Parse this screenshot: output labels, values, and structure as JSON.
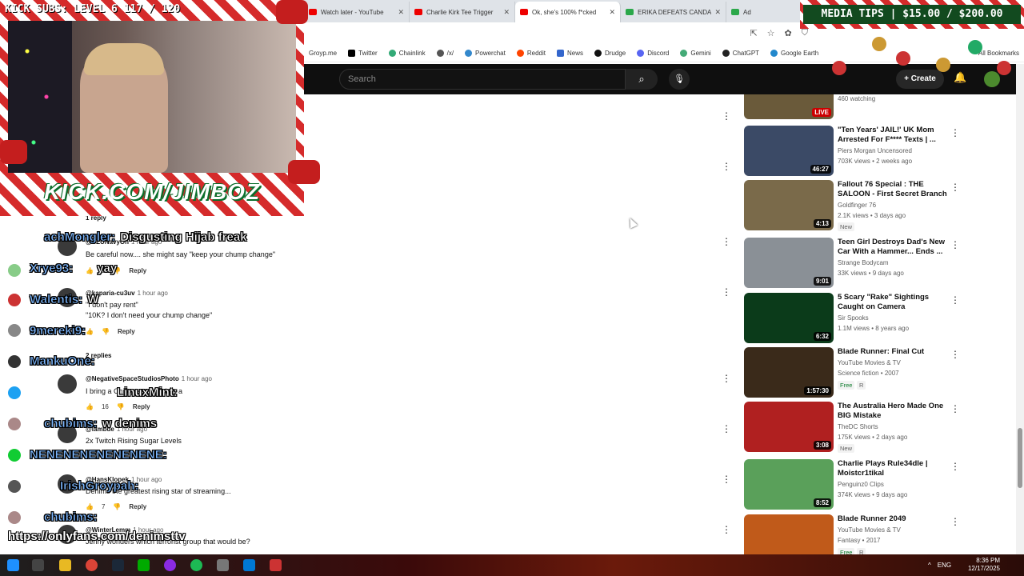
{
  "browser": {
    "tabs": [
      {
        "title": "Watch later - YouTube",
        "active": false,
        "favicon": "youtube"
      },
      {
        "title": "Charlie Kirk Tee Trigger",
        "active": false,
        "favicon": "youtube"
      },
      {
        "title": "Ok, she's 100% f*cked",
        "active": true,
        "favicon": "youtube"
      },
      {
        "title": "ERIKA DEFEATS CANDA",
        "active": false,
        "favicon": "rumble"
      },
      {
        "title": "Ad",
        "active": false,
        "favicon": "kick"
      }
    ],
    "bookmarks": [
      "Groyp.me",
      "Twitter",
      "Chainlink",
      "/x/",
      "Powerchat",
      "Reddit",
      "News",
      "Drudge",
      "Discord",
      "Gemini",
      "ChatGPT",
      "Google Earth"
    ],
    "all_bookmarks_label": "All Bookmarks"
  },
  "youtube": {
    "search_placeholder": "Search",
    "create_label": "Create"
  },
  "overlay": {
    "kick_subs": "KICK SUBS: LEVEL 6 117 / 120",
    "media_tips": "MEDIA TIPS | $15.00 / $200.00",
    "channel_url": "KICK.COM/JIMBOZ",
    "bottom_url": "https://onlyfans.com/denimsttv"
  },
  "chat": [
    {
      "name": "achMongler:",
      "message": "Disgusting Hijab freak"
    },
    {
      "name": "Xrye93:",
      "message": "yay"
    },
    {
      "name": "Walentis:",
      "message": "W"
    },
    {
      "name": "9mereki9:",
      "message": ""
    },
    {
      "name": "MankuOne:",
      "message": ""
    },
    {
      "name": "",
      "message": "LinuxMint:"
    },
    {
      "name": "chubims:",
      "message": "w denims"
    },
    {
      "name": "NENENENENENENENE:",
      "message": ""
    },
    {
      "name": "IrishGroypah:",
      "message": ""
    },
    {
      "name": "chubims:",
      "message": ""
    }
  ],
  "comments": [
    {
      "author": "@SZUNavyOn",
      "ago": "1 hour ago",
      "text": "Be careful now.... she might say \"keep your chump change\"",
      "likes": "3",
      "reply": "Reply"
    },
    {
      "author": "@kaparia-cu3uv",
      "ago": "1 hour ago",
      "text": "\"I don't pay rent\"",
      "text2": "\"10K? I don't need your chump change\"",
      "likes": "",
      "reply": "Reply",
      "replies_label": "2 replies"
    },
    {
      "author": "@NegativeSpaceStudiosPhoto",
      "ago": "1 hour ago",
      "text": "I bring a Chiropractor makes a",
      "likes": "16",
      "reply": "Reply"
    },
    {
      "author": "@iambde",
      "ago": "1 hour ago",
      "text": "2x Twitch Rising Sugar Levels",
      "likes": "",
      "reply": ""
    },
    {
      "author": "@HansKlopek",
      "ago": "1 hour ago",
      "text": "Denims the greatest rising star of streaming...",
      "likes": "7",
      "reply": "Reply"
    },
    {
      "author": "@WinterLemm",
      "ago": "1 hour ago",
      "text": "Jenny wonders which terrorist group that would be?",
      "likes": "",
      "reply": ""
    }
  ],
  "first_replies_label": "1 reply",
  "sidebar": [
    {
      "title": "",
      "channel": "460 watching",
      "meta": "",
      "duration": "LIVE",
      "badge": "",
      "thumb": "#6a5a3a"
    },
    {
      "title": "\"Ten Years' JAIL!' UK Mom Arrested For F**** Texts | ...",
      "channel": "Piers Morgan Uncensored",
      "meta": "703K views • 2 weeks ago",
      "duration": "46:27",
      "badge": "",
      "thumb": "#3b4a66"
    },
    {
      "title": "Fallout 76 Special : THE SALOON - First Secret Branch ...",
      "channel": "Goldfinger 76",
      "meta": "2.1K views • 3 days ago",
      "duration": "4:13",
      "badge": "New",
      "thumb": "#7a6a4a"
    },
    {
      "title": "Teen Girl Destroys Dad's New Car With a Hammer... Ends ...",
      "channel": "Strange Bodycam",
      "meta": "33K views • 9 days ago",
      "duration": "9:01",
      "badge": "",
      "thumb": "#8a9096"
    },
    {
      "title": "5 Scary \"Rake\" Sightings Caught on Camera",
      "channel": "Sir Spooks",
      "meta": "1.1M views • 8 years ago",
      "duration": "6:32",
      "badge": "",
      "thumb": "#0b3b1a"
    },
    {
      "title": "Blade Runner: Final Cut",
      "channel": "YouTube Movies & TV",
      "meta": "Science fiction • 2007",
      "duration": "1:57:30",
      "badge": "Free",
      "rating": "R",
      "thumb": "#3a2a1a"
    },
    {
      "title": "The Australia Hero Made One BIG Mistake",
      "channel": "TheDC Shorts",
      "meta": "175K views • 2 days ago",
      "duration": "3:08",
      "badge": "New",
      "thumb": "#b02020"
    },
    {
      "title": "Charlie Plays Rule34dle | Moistcr1tikal",
      "channel": "Penguinz0 Clips",
      "meta": "374K views • 9 days ago",
      "duration": "8:52",
      "badge": "",
      "thumb": "#5aa05a"
    },
    {
      "title": "Blade Runner 2049",
      "channel": "YouTube Movies & TV",
      "meta": "Fantasy • 2017",
      "duration": "",
      "badge": "Free",
      "rating": "R",
      "thumb": "#c05a1a"
    }
  ],
  "taskbar": {
    "lang": "ENG",
    "time": "8:36 PM",
    "date": "12/17/2025"
  },
  "colors": {
    "yt_header": "#0f0f0f",
    "candy_red": "#d52b2b",
    "chat_name": "#7db8ff"
  }
}
